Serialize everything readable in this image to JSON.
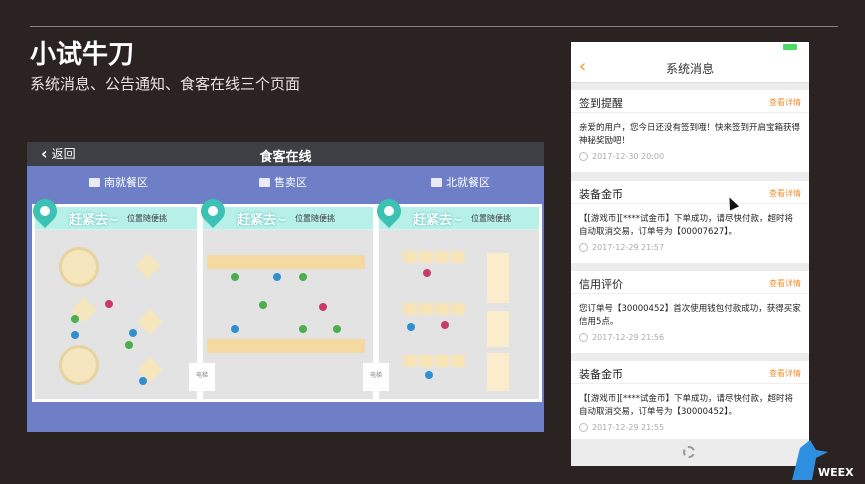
{
  "slide": {
    "title": "小试牛刀",
    "subtitle": "系统消息、公告通知、食客在线三个页面"
  },
  "map": {
    "back_label": "返回",
    "title": "食客在线",
    "zones": [
      {
        "label": "南就餐区"
      },
      {
        "label": "售卖区"
      },
      {
        "label": "北就餐区"
      }
    ],
    "banner_go": "赶紧去~",
    "banner_tip": "位置随便挑",
    "elevator_label": "电梯"
  },
  "phone": {
    "nav_title": "系统消息",
    "messages": [
      {
        "title": "签到提醒",
        "more": "查看详情",
        "body": "亲爱的用户，您今日还没有签到哦！快来签到开启宝箱获得神秘奖励吧！",
        "time": "2017-12-30 20:00"
      },
      {
        "title": "装备金币",
        "more": "查看详情",
        "body": "【[游戏币][****试金币】下单成功，请尽快付款，超时将自动取消交易，订单号为【00007627】。",
        "time": "2017-12-29 21:57"
      },
      {
        "title": "信用评价",
        "more": "查看详情",
        "body": "您订单号【30000452】首次使用钱包付款成功，获得买家信用5点。",
        "time": "2017-12-29 21:56"
      },
      {
        "title": "装备金币",
        "more": "查看详情",
        "body": "【[游戏币][****试金币】下单成功，请尽快付款，超时将自动取消交易，订单号为【30000452】。",
        "time": "2017-12-29 21:55"
      }
    ]
  },
  "brand": {
    "name": "WEEX"
  },
  "colors": {
    "accent": "#f0902f",
    "map_bg": "#6e7fc7",
    "pin": "#3cc2b4"
  }
}
